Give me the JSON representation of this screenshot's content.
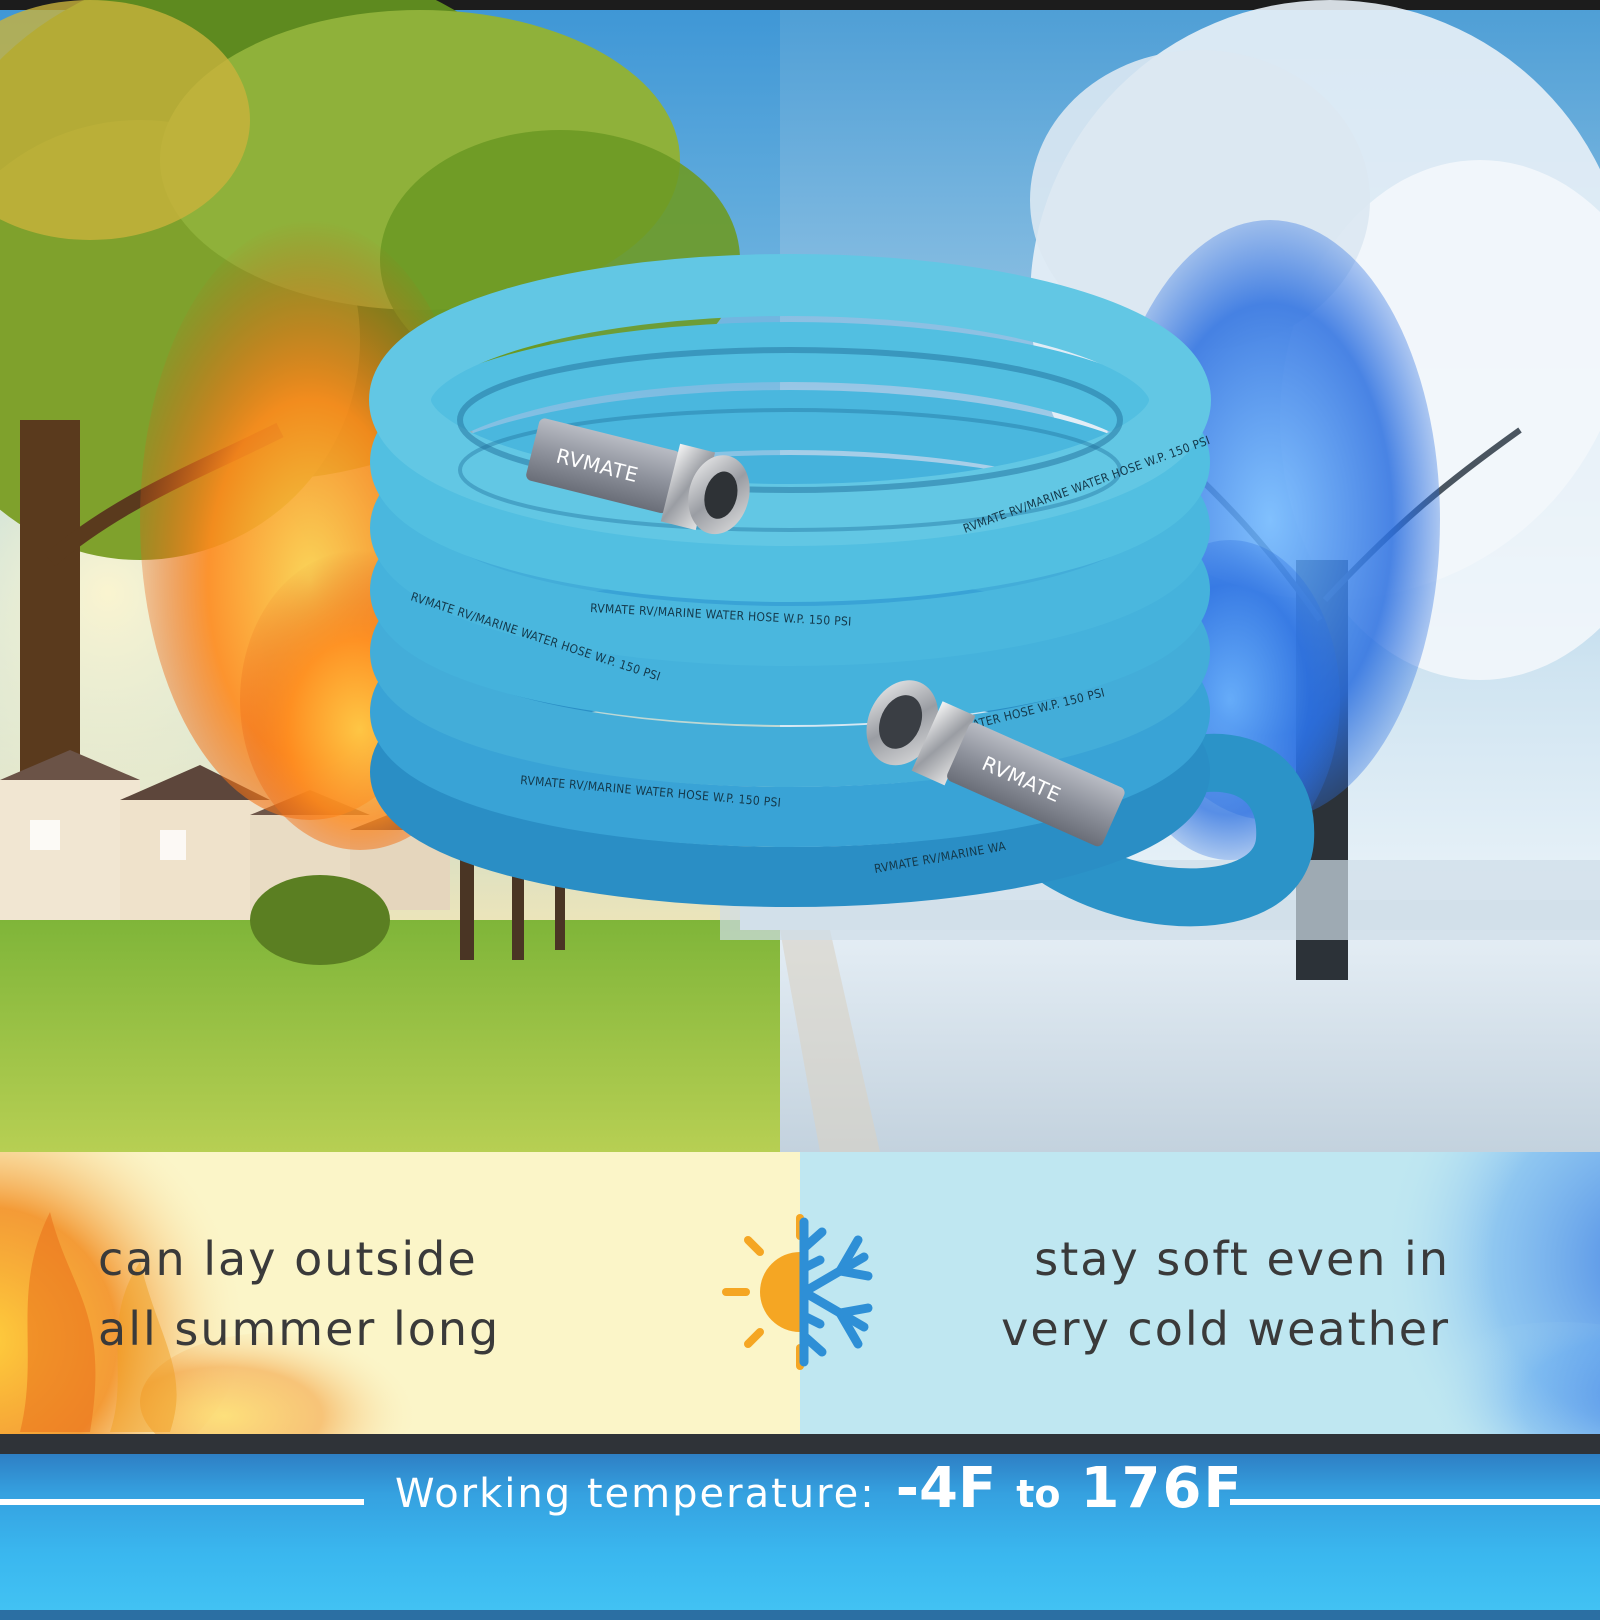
{
  "hose": {
    "brand": "RVMATE",
    "print_text": "RVMATE RV/MARINE WATER HOSE W.P. 150 PSI",
    "print_text_partial_right": "NE WATER HOSE W.P. 150 PSI",
    "print_text_partial_bottom": "RVMATE RV/MARINE WA",
    "color": "#4bb3e0"
  },
  "features": {
    "summer": {
      "line1": "can lay outside",
      "line2": "all summer long",
      "background": "#fbf5c8"
    },
    "icon": "sun-snowflake-icon",
    "winter": {
      "line1": "stay soft even in",
      "line2": "very cold weather",
      "background": "#bfe7f1"
    }
  },
  "temperature": {
    "prefix": "Working temperature:",
    "min": "-4F",
    "connector": "to",
    "max": "176F"
  },
  "colors": {
    "sun": "#f5a623",
    "snowflake": "#2e8fd6",
    "banner": "#35a1e0"
  }
}
